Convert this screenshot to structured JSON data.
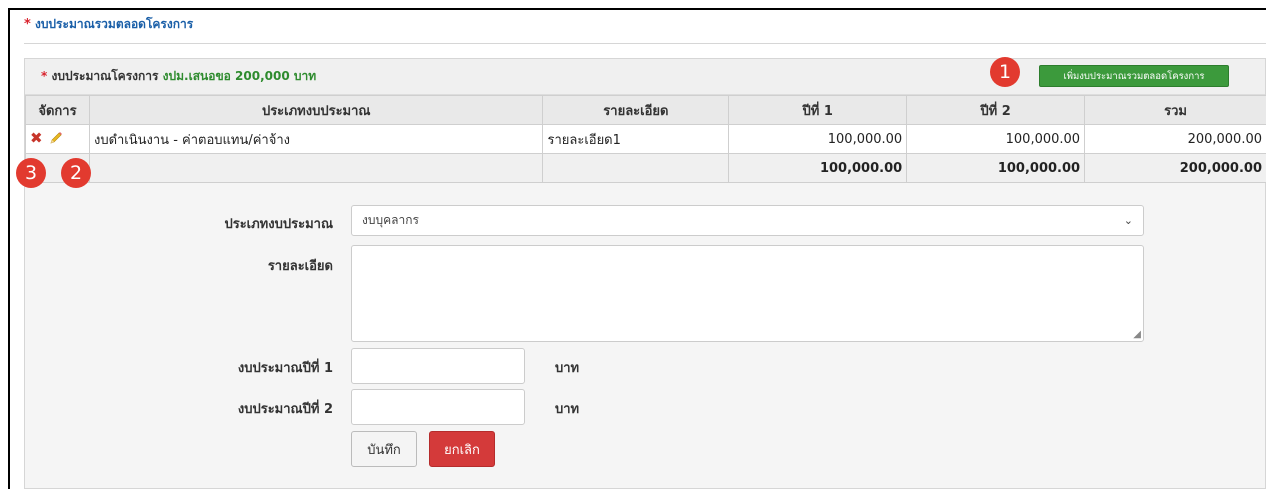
{
  "section": {
    "star": "*",
    "title": "งบประมาณรวมตลอดโครงการ"
  },
  "panel": {
    "star": "*",
    "label": "งบประมาณโครงการ",
    "amount_text": "งปม.เสนอขอ 200,000 บาท",
    "add_button": "เพิ่มงบประมาณรวมตลอดโครงการ"
  },
  "badges": {
    "add": "1",
    "edit": "2",
    "delete": "3"
  },
  "table": {
    "headers": [
      "จัดการ",
      "ประเภทงบประมาณ",
      "รายละเอียด",
      "ปีที่ 1",
      "ปีที่ 2",
      "รวม"
    ],
    "rows": [
      {
        "type": "งบดำเนินงาน - ค่าตอบแทน/ค่าจ้าง",
        "detail": "รายละเอียด1",
        "year1": "100,000.00",
        "year2": "100,000.00",
        "total": "200,000.00"
      }
    ],
    "footer": {
      "year1": "100,000.00",
      "year2": "100,000.00",
      "total": "200,000.00"
    }
  },
  "form": {
    "type_label": "ประเภทงบประมาณ",
    "type_value": "งบบุคลากร",
    "detail_label": "รายละเอียด",
    "year1_label": "งบประมาณปีที่ 1",
    "year2_label": "งบประมาณปีที่ 2",
    "unit": "บาท",
    "save_button": "บันทึก",
    "cancel_button": "ยกเลิก"
  },
  "icons": {
    "delete": "close-x-icon",
    "edit": "pencil-icon",
    "dropdown": "chevron-down-icon"
  },
  "colors": {
    "accent_green": "#3c9a3c",
    "danger_red": "#d43a3a",
    "title_blue": "#1a5fa8",
    "badge_red": "#e23a2f"
  }
}
